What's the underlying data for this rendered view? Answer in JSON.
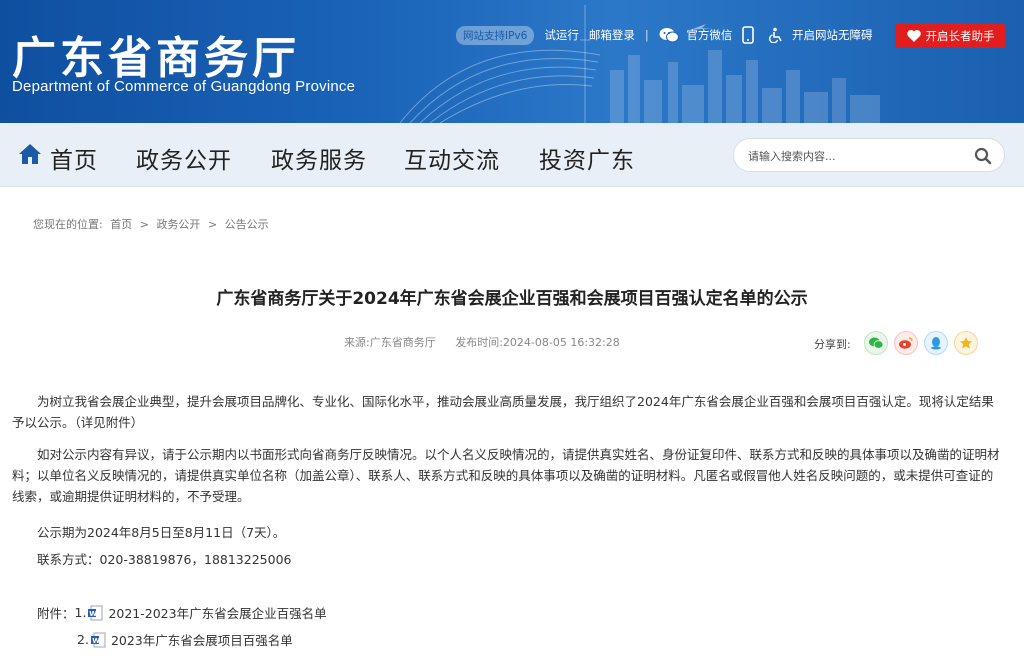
{
  "header": {
    "title": "广东省商务厅",
    "subtitle": "Department of Commerce of Guangdong Province",
    "ipv6_badge": "网站支持IPv6",
    "links": {
      "trial": "试运行",
      "mail": "邮箱登录",
      "wechat": "官方微信",
      "accessibility": "开启网站无障碍",
      "elder": "开启长者助手"
    },
    "brand_color": "#1a63b8",
    "elder_color": "#e21d1d"
  },
  "nav": {
    "items": [
      "首页",
      "政务公开",
      "政务服务",
      "互动交流",
      "投资广东"
    ],
    "search_placeholder": "请输入搜索内容..."
  },
  "breadcrumb": {
    "prefix": "您现在的位置:",
    "items": [
      "首页",
      "政务公开",
      "公告公示"
    ],
    "separator": ">"
  },
  "article": {
    "title": "广东省商务厅关于2024年广东省会展企业百强和会展项目百强认定名单的公示",
    "source": "来源:广东省商务厅",
    "published": "发布时间:2024-08-05 16:32:28",
    "share_label": "分享到:",
    "share_icons": [
      "wechat-icon",
      "weibo-icon",
      "qq-icon",
      "qzone-icon"
    ],
    "paragraphs": [
      "为树立我省会展企业典型，提升会展项目品牌化、专业化、国际化水平，推动会展业高质量发展，我厅组织了2024年广东省会展企业百强和会展项目百强认定。现将认定结果予以公示。（详见附件）",
      "如对公示内容有异议，请于公示期内以书面形式向省商务厅反映情况。以个人名义反映情况的，请提供真实姓名、身份证复印件、联系方式和反映的具体事项以及确凿的证明材料；以单位名义反映情况的，请提供真实单位名称（加盖公章）、联系人、联系方式和反映的具体事项以及确凿的证明材料。凡匿名或假冒他人姓名反映问题的，或未提供可查证的线索，或逾期提供证明材料的，不予受理。",
      "公示期为2024年8月5日至8月11日（7天）。",
      "联系方式：020-38819876，18813225006"
    ],
    "attachments_label": "附件：",
    "attachments": [
      {
        "index": "1.",
        "name": "2021-2023年广东省会展企业百强名单"
      },
      {
        "index": "2.",
        "name": "2023年广东省会展项目百强名单"
      }
    ]
  }
}
